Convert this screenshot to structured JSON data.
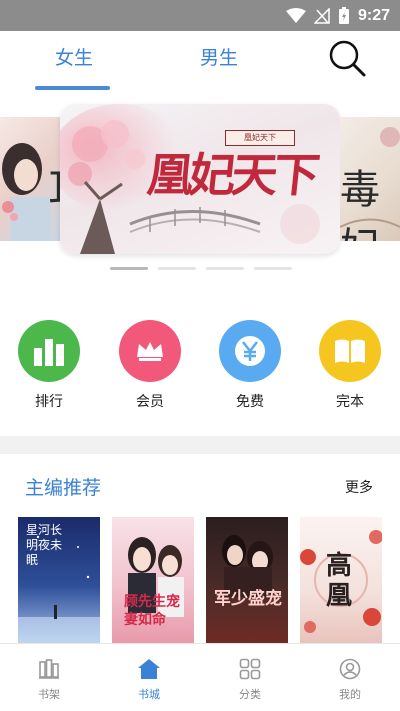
{
  "status_bar": {
    "time": "9:27"
  },
  "top_tabs": {
    "female": "女生",
    "male": "男生"
  },
  "banner": {
    "title": "凰妃天下",
    "stamp_text": "凰妃天下",
    "right_peek_text": "毒妃",
    "left_peek_text": "耳"
  },
  "categories": [
    {
      "label": "排行",
      "icon": "ranking-bars-icon",
      "color": "#4cb84c"
    },
    {
      "label": "会员",
      "icon": "crown-icon",
      "color": "#f2587a"
    },
    {
      "label": "免费",
      "icon": "yen-icon",
      "color": "#5aaaf2"
    },
    {
      "label": "完本",
      "icon": "open-book-icon",
      "color": "#f5c520"
    }
  ],
  "section": {
    "title": "主编推荐",
    "more": "更多"
  },
  "books": [
    {
      "cover_text": "星河长明夜未眠",
      "colors": [
        "#1a2b6a",
        "#3d6bb8"
      ]
    },
    {
      "cover_text": "顾先生宠妻如命",
      "colors": [
        "#f6d4dc",
        "#e89aaa"
      ]
    },
    {
      "cover_text": "军少盛宠",
      "colors": [
        "#3a2a2a",
        "#b3453c"
      ]
    },
    {
      "cover_text": "高凰",
      "colors": [
        "#f8ede8",
        "#d9473a"
      ]
    }
  ],
  "bottom_nav": [
    {
      "label": "书架",
      "icon": "bookshelf-icon"
    },
    {
      "label": "书城",
      "icon": "home-icon",
      "active": true
    },
    {
      "label": "分类",
      "icon": "category-grid-icon"
    },
    {
      "label": "我的",
      "icon": "profile-icon"
    }
  ],
  "colors": {
    "accent": "#3b82d6"
  }
}
